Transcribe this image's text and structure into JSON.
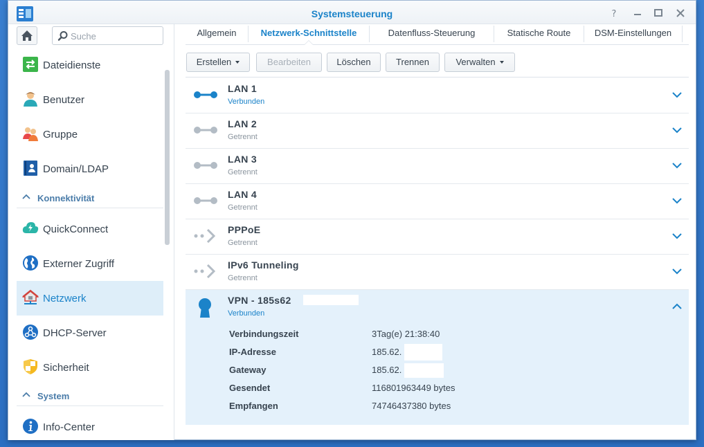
{
  "window": {
    "title": "Systemsteuerung"
  },
  "sidebar": {
    "search_placeholder": "Suche",
    "items": [
      {
        "label": "Dateidienste"
      },
      {
        "label": "Benutzer"
      },
      {
        "label": "Gruppe"
      },
      {
        "label": "Domain/LDAP"
      }
    ],
    "section_connectivity": "Konnektivität",
    "connectivity_items": [
      {
        "label": "QuickConnect"
      },
      {
        "label": "Externer Zugriff"
      },
      {
        "label": "Netzwerk"
      },
      {
        "label": "DHCP-Server"
      },
      {
        "label": "Sicherheit"
      }
    ],
    "section_system": "System",
    "system_items": [
      {
        "label": "Info-Center"
      }
    ]
  },
  "tabs": [
    {
      "label": "Allgemein"
    },
    {
      "label": "Netzwerk-Schnittstelle"
    },
    {
      "label": "Datenfluss-Steuerung"
    },
    {
      "label": "Statische Route"
    },
    {
      "label": "DSM-Einstellungen"
    }
  ],
  "toolbar": {
    "create": "Erstellen",
    "edit": "Bearbeiten",
    "delete": "Löschen",
    "disconnect": "Trennen",
    "manage": "Verwalten"
  },
  "interfaces": [
    {
      "name": "LAN 1",
      "status": "Verbunden"
    },
    {
      "name": "LAN 2",
      "status": "Getrennt"
    },
    {
      "name": "LAN 3",
      "status": "Getrennt"
    },
    {
      "name": "LAN 4",
      "status": "Getrennt"
    },
    {
      "name": "PPPoE",
      "status": "Getrennt"
    },
    {
      "name": "IPv6 Tunneling",
      "status": "Getrennt"
    }
  ],
  "vpn": {
    "name": "VPN - 185s62",
    "status": "Verbunden",
    "details": [
      {
        "key": "Verbindungszeit",
        "value": "3Tag(e) 21:38:40"
      },
      {
        "key": "IP-Adresse",
        "value": "185.62."
      },
      {
        "key": "Gateway",
        "value": "185.62."
      },
      {
        "key": "Gesendet",
        "value": "116801963449 bytes"
      },
      {
        "key": "Empfangen",
        "value": "74746437380 bytes"
      }
    ]
  },
  "colors": {
    "accent": "#1b83c9",
    "connected_icon": "#1b83c9",
    "disconnected_icon": "#b3bcc5",
    "selected_bg": "#deeef9"
  }
}
